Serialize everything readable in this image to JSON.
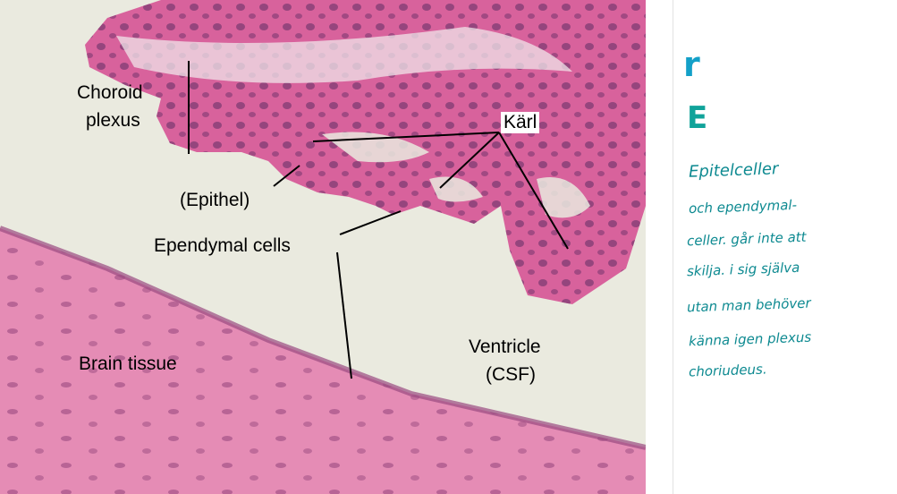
{
  "labels": {
    "choroid_plexus": [
      "Choroid",
      "plexus"
    ],
    "epithel": "(Epithel)",
    "karl": "Kärl",
    "ependymal": "Ependymal cells",
    "brain": "Brain tissue",
    "ventricle": [
      "Ventricle",
      "(CSF)"
    ]
  },
  "notes": {
    "mark_r": "r",
    "mark_e": "E",
    "lines": [
      "Epitelceller",
      "och ependymal-",
      "celler. går inte att",
      "skilja. i sig själva",
      "utan man behöver",
      "känna igen plexus",
      "choriudeus."
    ]
  },
  "colors": {
    "tissue": "#d8629c",
    "brain": "#e58cb5",
    "nuclei": "#8a3f78",
    "ventricle": "#eaeadf",
    "ink": "#0e8a91"
  }
}
